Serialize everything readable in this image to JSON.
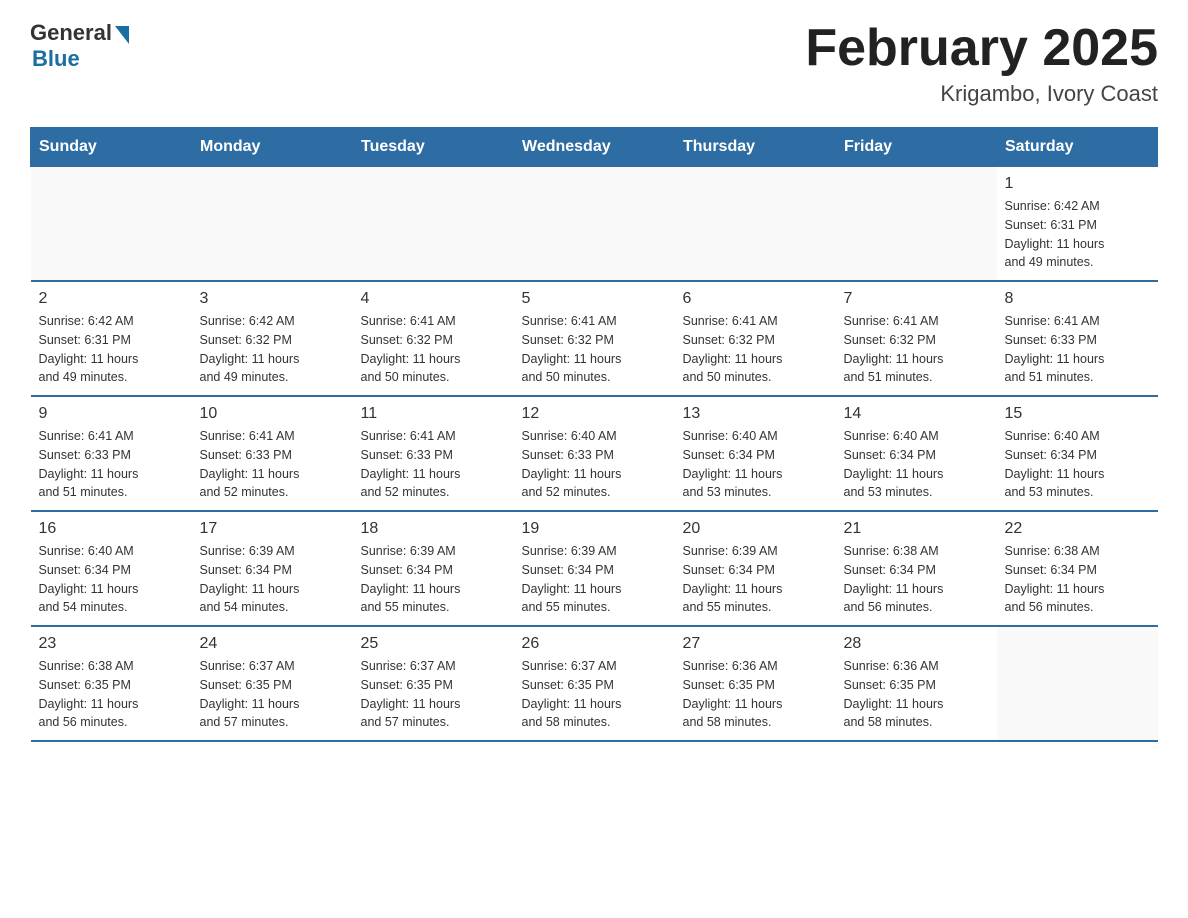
{
  "header": {
    "logo_general": "General",
    "logo_blue": "Blue",
    "month_title": "February 2025",
    "location": "Krigambo, Ivory Coast"
  },
  "calendar": {
    "days_of_week": [
      "Sunday",
      "Monday",
      "Tuesday",
      "Wednesday",
      "Thursday",
      "Friday",
      "Saturday"
    ],
    "weeks": [
      [
        {
          "day": "",
          "info": ""
        },
        {
          "day": "",
          "info": ""
        },
        {
          "day": "",
          "info": ""
        },
        {
          "day": "",
          "info": ""
        },
        {
          "day": "",
          "info": ""
        },
        {
          "day": "",
          "info": ""
        },
        {
          "day": "1",
          "info": "Sunrise: 6:42 AM\nSunset: 6:31 PM\nDaylight: 11 hours\nand 49 minutes."
        }
      ],
      [
        {
          "day": "2",
          "info": "Sunrise: 6:42 AM\nSunset: 6:31 PM\nDaylight: 11 hours\nand 49 minutes."
        },
        {
          "day": "3",
          "info": "Sunrise: 6:42 AM\nSunset: 6:32 PM\nDaylight: 11 hours\nand 49 minutes."
        },
        {
          "day": "4",
          "info": "Sunrise: 6:41 AM\nSunset: 6:32 PM\nDaylight: 11 hours\nand 50 minutes."
        },
        {
          "day": "5",
          "info": "Sunrise: 6:41 AM\nSunset: 6:32 PM\nDaylight: 11 hours\nand 50 minutes."
        },
        {
          "day": "6",
          "info": "Sunrise: 6:41 AM\nSunset: 6:32 PM\nDaylight: 11 hours\nand 50 minutes."
        },
        {
          "day": "7",
          "info": "Sunrise: 6:41 AM\nSunset: 6:32 PM\nDaylight: 11 hours\nand 51 minutes."
        },
        {
          "day": "8",
          "info": "Sunrise: 6:41 AM\nSunset: 6:33 PM\nDaylight: 11 hours\nand 51 minutes."
        }
      ],
      [
        {
          "day": "9",
          "info": "Sunrise: 6:41 AM\nSunset: 6:33 PM\nDaylight: 11 hours\nand 51 minutes."
        },
        {
          "day": "10",
          "info": "Sunrise: 6:41 AM\nSunset: 6:33 PM\nDaylight: 11 hours\nand 52 minutes."
        },
        {
          "day": "11",
          "info": "Sunrise: 6:41 AM\nSunset: 6:33 PM\nDaylight: 11 hours\nand 52 minutes."
        },
        {
          "day": "12",
          "info": "Sunrise: 6:40 AM\nSunset: 6:33 PM\nDaylight: 11 hours\nand 52 minutes."
        },
        {
          "day": "13",
          "info": "Sunrise: 6:40 AM\nSunset: 6:34 PM\nDaylight: 11 hours\nand 53 minutes."
        },
        {
          "day": "14",
          "info": "Sunrise: 6:40 AM\nSunset: 6:34 PM\nDaylight: 11 hours\nand 53 minutes."
        },
        {
          "day": "15",
          "info": "Sunrise: 6:40 AM\nSunset: 6:34 PM\nDaylight: 11 hours\nand 53 minutes."
        }
      ],
      [
        {
          "day": "16",
          "info": "Sunrise: 6:40 AM\nSunset: 6:34 PM\nDaylight: 11 hours\nand 54 minutes."
        },
        {
          "day": "17",
          "info": "Sunrise: 6:39 AM\nSunset: 6:34 PM\nDaylight: 11 hours\nand 54 minutes."
        },
        {
          "day": "18",
          "info": "Sunrise: 6:39 AM\nSunset: 6:34 PM\nDaylight: 11 hours\nand 55 minutes."
        },
        {
          "day": "19",
          "info": "Sunrise: 6:39 AM\nSunset: 6:34 PM\nDaylight: 11 hours\nand 55 minutes."
        },
        {
          "day": "20",
          "info": "Sunrise: 6:39 AM\nSunset: 6:34 PM\nDaylight: 11 hours\nand 55 minutes."
        },
        {
          "day": "21",
          "info": "Sunrise: 6:38 AM\nSunset: 6:34 PM\nDaylight: 11 hours\nand 56 minutes."
        },
        {
          "day": "22",
          "info": "Sunrise: 6:38 AM\nSunset: 6:34 PM\nDaylight: 11 hours\nand 56 minutes."
        }
      ],
      [
        {
          "day": "23",
          "info": "Sunrise: 6:38 AM\nSunset: 6:35 PM\nDaylight: 11 hours\nand 56 minutes."
        },
        {
          "day": "24",
          "info": "Sunrise: 6:37 AM\nSunset: 6:35 PM\nDaylight: 11 hours\nand 57 minutes."
        },
        {
          "day": "25",
          "info": "Sunrise: 6:37 AM\nSunset: 6:35 PM\nDaylight: 11 hours\nand 57 minutes."
        },
        {
          "day": "26",
          "info": "Sunrise: 6:37 AM\nSunset: 6:35 PM\nDaylight: 11 hours\nand 58 minutes."
        },
        {
          "day": "27",
          "info": "Sunrise: 6:36 AM\nSunset: 6:35 PM\nDaylight: 11 hours\nand 58 minutes."
        },
        {
          "day": "28",
          "info": "Sunrise: 6:36 AM\nSunset: 6:35 PM\nDaylight: 11 hours\nand 58 minutes."
        },
        {
          "day": "",
          "info": ""
        }
      ]
    ]
  }
}
